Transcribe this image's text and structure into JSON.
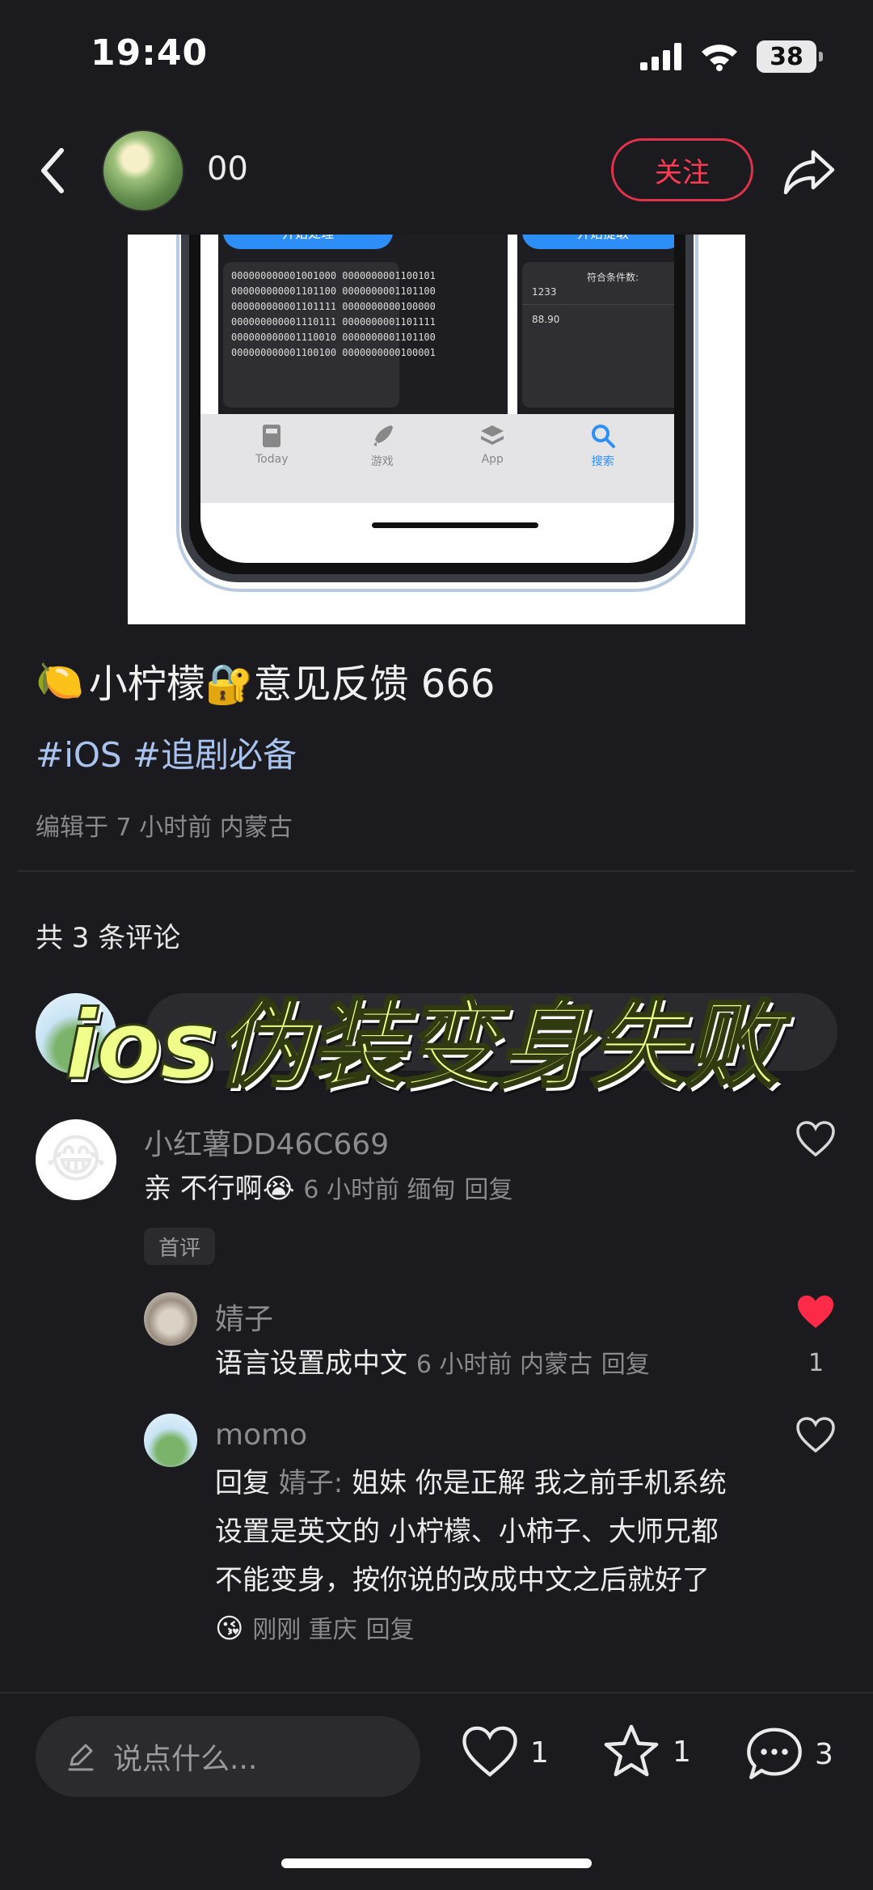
{
  "status_bar": {
    "time": "19:40",
    "battery": "38"
  },
  "header": {
    "username": "00",
    "follow_label": "关注"
  },
  "post_image": {
    "left_button": "开始处理",
    "right_button": "开始提取",
    "code_lines": "000000000001001000 0000000001100101\n000000000001101100 0000000001101100\n000000000001101111 0000000000100000\n000000000001110111 0000000001101111\n000000000001110010 0000000001101100\n000000000001100100 0000000000100001",
    "result_label": "符合条件数:",
    "result_values": [
      "1233",
      "88.90"
    ],
    "tabs": [
      {
        "label": "Today",
        "icon": "today-icon"
      },
      {
        "label": "游戏",
        "icon": "rocket-icon"
      },
      {
        "label": "App",
        "icon": "layers-icon"
      },
      {
        "label": "搜索",
        "icon": "search-icon"
      }
    ]
  },
  "post": {
    "title": "小柠檬🔐意见反馈 666",
    "title_emoji": "🍋",
    "hashtags": "#iOS #追剧必备",
    "meta": "编辑于 7 小时前 内蒙古"
  },
  "comments_header": "共 3 条评论",
  "overlay_title": "ios伪装变身失败",
  "comments": [
    {
      "name": "小红薯DD46C669",
      "text": "亲 不行啊",
      "emoji": "😭",
      "meta": "6 小时前 缅甸",
      "reply": "回复",
      "tag": "首评"
    },
    {
      "name": "婧子",
      "text": "语言设置成中文",
      "meta": "6 小时前 内蒙古",
      "reply": "回复",
      "likes": "1"
    },
    {
      "name": "momo",
      "reply_prefix": "回复",
      "reply_to": "婧子:",
      "text": "姐妹 你是正解 我之前手机系统设置是英文的 小柠檬、小柿子、大师兄都不能变身，按你说的改成中文之后就好了",
      "emoji": "😘",
      "meta": "刚刚 重庆",
      "reply": "回复"
    }
  ],
  "bottom_bar": {
    "placeholder": "说点什么...",
    "likes": "1",
    "stars": "1",
    "comments": "3"
  },
  "colors": {
    "accent_red": "#ff3b54",
    "hashtag_blue": "#a9c3ef",
    "overlay_yellow": "#efff8a"
  }
}
